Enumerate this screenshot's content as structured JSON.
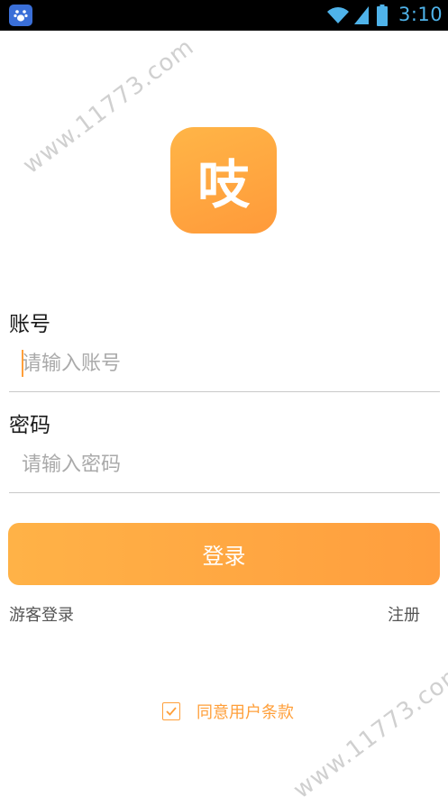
{
  "status_bar": {
    "time": "3:10",
    "app_icon": "baidu-paw-icon",
    "wifi_icon": "wifi-icon",
    "signal_icon": "signal-icon",
    "battery_icon": "battery-icon",
    "time_color": "#4fb3ea"
  },
  "logo": {
    "glyph": "吱",
    "colors": [
      "#ffb547",
      "#ff9a3a"
    ]
  },
  "account": {
    "label": "账号",
    "placeholder": "请输入账号",
    "value": ""
  },
  "password": {
    "label": "密码",
    "placeholder": "请输入密码",
    "value": ""
  },
  "login_button": {
    "label": "登录",
    "color": "#ffa942"
  },
  "links": {
    "guest_login": "游客登录",
    "register": "注册"
  },
  "agreement": {
    "checked": true,
    "text": "同意用户条款",
    "accent_color": "#ff9f3a"
  },
  "watermark": {
    "text": "www.11773.com"
  }
}
